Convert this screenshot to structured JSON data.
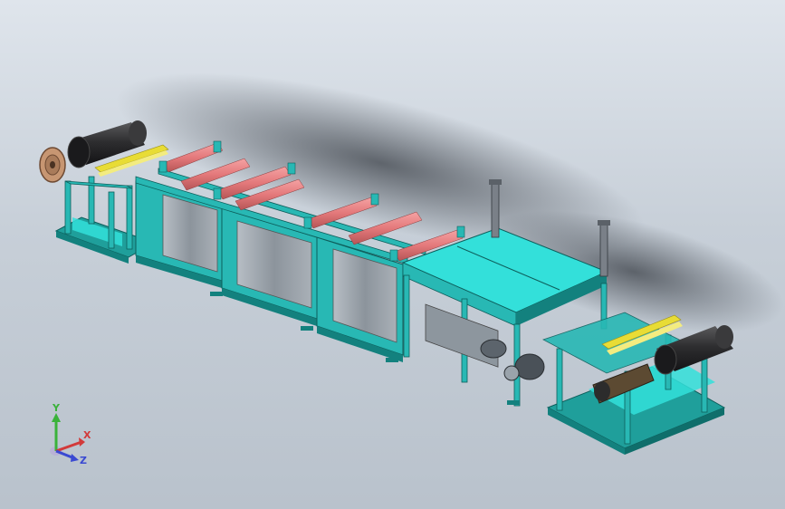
{
  "scene": {
    "model": "production-line-assembly",
    "colors": {
      "background_top": "#dfe5ec",
      "background_bottom": "#b9c2cc",
      "frame": "#28b8b4",
      "frame_dark": "#13817e",
      "panel_top": "#33e0da",
      "tank": "#9ea6ae",
      "roller_red": "#e4797b",
      "coil_dark": "#2e2e30",
      "belt_yellow": "#e8dc35"
    }
  },
  "triad": {
    "x_label": "X",
    "y_label": "Y",
    "z_label": "Z",
    "x_color": "#d23a3a",
    "y_color": "#3ab23a",
    "z_color": "#3a49d2"
  }
}
